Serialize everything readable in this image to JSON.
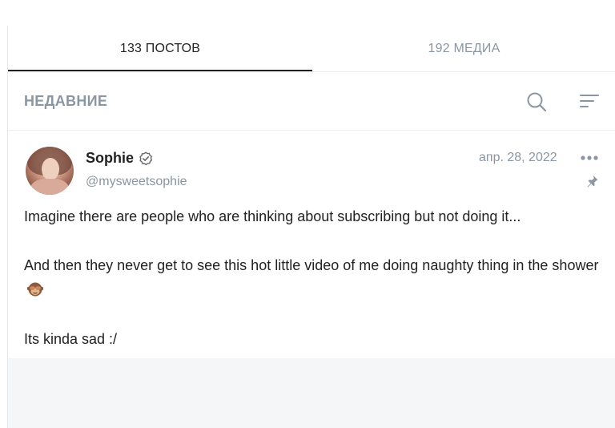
{
  "tabs": [
    {
      "label": "133 ПОСТОВ",
      "active": true
    },
    {
      "label": "192 МЕДИА",
      "active": false
    }
  ],
  "filter": {
    "label": "НЕДАВНИЕ",
    "search_icon": "search-icon",
    "sort_icon": "sort-icon"
  },
  "post": {
    "display_name": "Sophie",
    "username": "@mysweetsophie",
    "date": "апр. 28, 2022",
    "verified_icon": "verified-check-icon",
    "more_icon": "more-dots-icon",
    "pinned_icon": "pin-icon",
    "paragraphs": [
      "Imagine there are people who are thinking about subscribing but not doing it...",
      "And then they never get to see this hot little video of me doing naughty thing in the shower",
      "Its kinda sad :/"
    ],
    "emoji": "see-no-evil-monkey-emoji"
  },
  "colors": {
    "text": "#222222",
    "muted": "#8a96a3",
    "divider": "#e9ecee",
    "bottom_bg": "#f4f6f7"
  }
}
